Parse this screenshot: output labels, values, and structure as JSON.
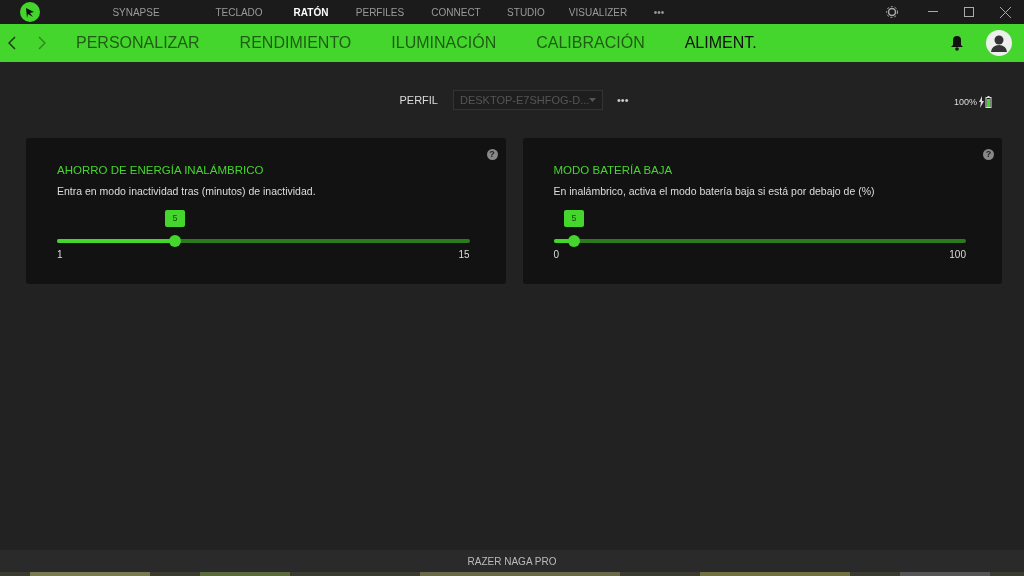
{
  "top_nav": {
    "items": [
      {
        "label": "SYNAPSE",
        "selected": false
      },
      {
        "label": "TECLADO",
        "selected": false
      },
      {
        "label": "RATÓN",
        "selected": true
      },
      {
        "label": "PERFILES",
        "selected": false
      },
      {
        "label": "CONNECT",
        "selected": false
      },
      {
        "label": "STUDIO",
        "selected": false
      },
      {
        "label": "VISUALIZER",
        "selected": false
      }
    ],
    "more": "•••"
  },
  "sub_nav": {
    "items": [
      {
        "label": "PERSONALIZAR",
        "selected": false
      },
      {
        "label": "RENDIMIENTO",
        "selected": false
      },
      {
        "label": "ILUMINACIÓN",
        "selected": false
      },
      {
        "label": "CALIBRACIÓN",
        "selected": false
      },
      {
        "label": "ALIMENT.",
        "selected": true
      }
    ]
  },
  "profile": {
    "label": "PERFIL",
    "value": "DESKTOP-E7SHFOG-D...",
    "more": "•••",
    "battery": "100%"
  },
  "cards": [
    {
      "title": "AHORRO DE ENERGÍA INALÁMBRICO",
      "description": "Entra en modo inactividad tras (minutos) de inactividad.",
      "help": "?",
      "value": "5",
      "level": 0.286,
      "min": "1",
      "max": "15"
    },
    {
      "title": "MODO BATERÍA BAJA",
      "description": "En inalámbrico, activa el modo batería baja si está por debajo de (%)",
      "help": "?",
      "value": "5",
      "level": 0.05,
      "min": "0",
      "max": "100"
    }
  ],
  "status_bar": {
    "device": "RAZER NAGA PRO"
  }
}
